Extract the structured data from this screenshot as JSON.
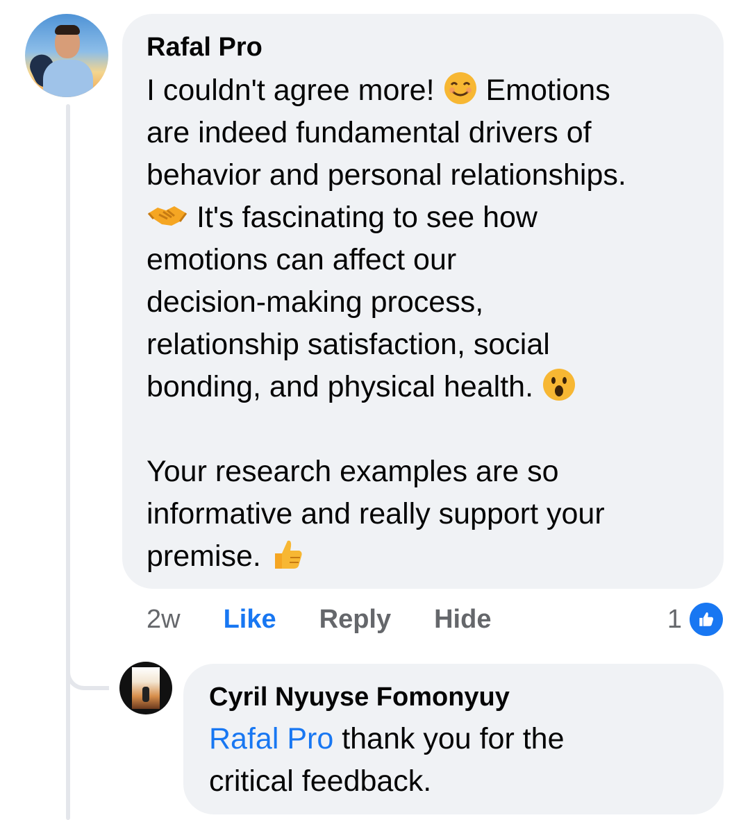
{
  "comment": {
    "author": "Rafal Pro",
    "lines": [
      "I couldn't agree more!",
      "Emotions",
      "are indeed fundamental drivers of",
      "behavior and personal relationships.",
      "It's fascinating to see how",
      "emotions can affect our",
      "decision-making process,",
      "relationship satisfaction, social",
      "bonding, and physical health.",
      "Your research examples are so",
      "informative and really support your",
      "premise."
    ],
    "emojis": [
      "smiling-face-icon",
      "handshake-icon",
      "astonished-face-icon",
      "thumbs-up-icon"
    ],
    "time": "2w",
    "like_label": "Like",
    "reply_label": "Reply",
    "hide_label": "Hide",
    "reaction_count": "1"
  },
  "reply": {
    "author": "Cyril Nyuyse Fomonyuy",
    "mention": "Rafal Pro",
    "text_line1": " thank you for the",
    "text_line2": "critical feedback."
  },
  "colors": {
    "bubble": "#f0f2f5",
    "link_blue": "#1877f2",
    "meta_gray": "#65676b",
    "text": "#050505"
  }
}
